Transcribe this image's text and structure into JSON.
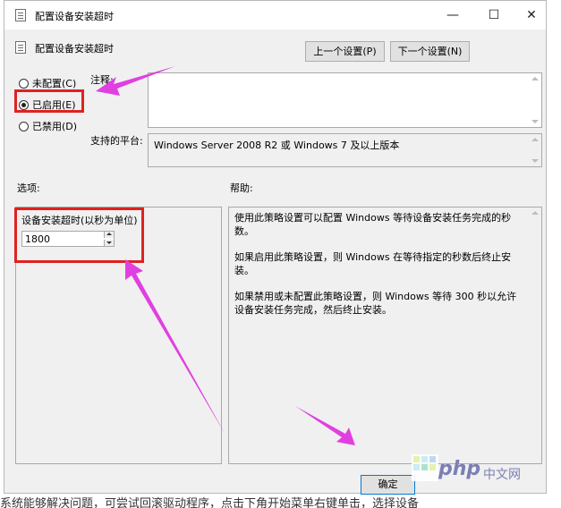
{
  "window": {
    "title": "配置设备安装超时",
    "controls": {
      "minimize": "—",
      "maximize": "☐",
      "close": "✕"
    }
  },
  "header": {
    "title": "配置设备安装超时",
    "prev_button": "上一个设置(P)",
    "next_button": "下一个设置(N)"
  },
  "state": {
    "options": [
      {
        "label": "未配置(C)",
        "selected": false
      },
      {
        "label": "已启用(E)",
        "selected": true
      },
      {
        "label": "已禁用(D)",
        "selected": false
      }
    ]
  },
  "comment": {
    "label": "注释:",
    "value": ""
  },
  "platform": {
    "label": "支持的平台:",
    "value": "Windows Server 2008 R2 或 Windows 7 及以上版本"
  },
  "options_panel": {
    "label": "选项:",
    "field_label": "设备安装超时(以秒为单位)",
    "field_value": "1800"
  },
  "help_panel": {
    "label": "帮助:",
    "paragraphs": [
      "使用此策略设置可以配置 Windows 等待设备安装任务完成的秒数。",
      "如果启用此策略设置，则 Windows 在等待指定的秒数后终止安装。",
      "如果禁用或未配置此策略设置，则 Windows 等待 300 秒以允许设备安装任务完成，然后终止安装。"
    ]
  },
  "footer": {
    "ok_button": "确定"
  },
  "overlay": {
    "logo_text": "php",
    "logo_site": "中文网",
    "caption": "系统能够解决问题，可尝试回滚驱动程序，点击下角开始菜单右键单击，选择设备"
  },
  "colors": {
    "highlight_red": "#e02121",
    "arrow_magenta": "#e040e0",
    "window_bg": "#f0f0f0",
    "logo_purple": "#7b7fb5"
  }
}
